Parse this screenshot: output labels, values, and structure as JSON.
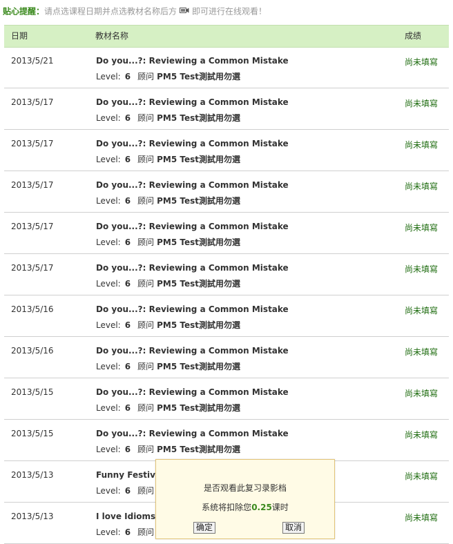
{
  "tip": {
    "label": "贴心提醒：",
    "text_before": "请点选课程日期并点选教材名称后方",
    "icon": "video-camera-icon",
    "text_after": "即可进行在线观看！"
  },
  "table": {
    "headers": {
      "date": "日期",
      "name": "教材名称",
      "score": "成绩"
    },
    "level_label": "Level:",
    "consultant_label": "顾问",
    "rows": [
      {
        "date": "2013/5/21",
        "title": "Do you...?: Reviewing a Common Mistake",
        "level": "6",
        "teacher": "PM5 Test測試用勿選",
        "score": "尚未填寫"
      },
      {
        "date": "2013/5/17",
        "title": "Do you...?: Reviewing a Common Mistake",
        "level": "6",
        "teacher": "PM5 Test測試用勿選",
        "score": "尚未填寫"
      },
      {
        "date": "2013/5/17",
        "title": "Do you...?: Reviewing a Common Mistake",
        "level": "6",
        "teacher": "PM5 Test測試用勿選",
        "score": "尚未填寫"
      },
      {
        "date": "2013/5/17",
        "title": "Do you...?: Reviewing a Common Mistake",
        "level": "6",
        "teacher": "PM5 Test測試用勿選",
        "score": "尚未填寫"
      },
      {
        "date": "2013/5/17",
        "title": "Do you...?: Reviewing a Common Mistake",
        "level": "6",
        "teacher": "PM5 Test測試用勿選",
        "score": "尚未填寫"
      },
      {
        "date": "2013/5/17",
        "title": "Do you...?: Reviewing a Common Mistake",
        "level": "6",
        "teacher": "PM5 Test測試用勿選",
        "score": "尚未填寫"
      },
      {
        "date": "2013/5/16",
        "title": "Do you...?: Reviewing a Common Mistake",
        "level": "6",
        "teacher": "PM5 Test測試用勿選",
        "score": "尚未填寫"
      },
      {
        "date": "2013/5/16",
        "title": "Do you...?: Reviewing a Common Mistake",
        "level": "6",
        "teacher": "PM5 Test測試用勿選",
        "score": "尚未填寫"
      },
      {
        "date": "2013/5/15",
        "title": "Do you...?: Reviewing a Common Mistake",
        "level": "6",
        "teacher": "PM5 Test測試用勿選",
        "score": "尚未填寫"
      },
      {
        "date": "2013/5/15",
        "title": "Do you...?: Reviewing a Common Mistake",
        "level": "6",
        "teacher": "PM5 Test測試用勿選",
        "score": "尚未填寫"
      },
      {
        "date": "2013/5/13",
        "title": "Funny Festivals",
        "level": "6",
        "teacher": "",
        "score": "尚未填寫"
      },
      {
        "date": "2013/5/13",
        "title": "I love Idioms: Id",
        "level": "6",
        "teacher": "",
        "score": "尚未填寫"
      }
    ]
  },
  "dialog": {
    "line1": "是否观看此复习录影档",
    "line2_before": "系统将扣除您",
    "line2_value": "0.25",
    "line2_after": "课时",
    "ok_label": "确定",
    "cancel_label": "取消"
  },
  "colors": {
    "header_bg": "#d6f0c4",
    "accent_green": "#3b8a1e",
    "score_green": "#1d6b0e",
    "dialog_bg": "#fffbe6",
    "dialog_border": "#e2c477"
  }
}
